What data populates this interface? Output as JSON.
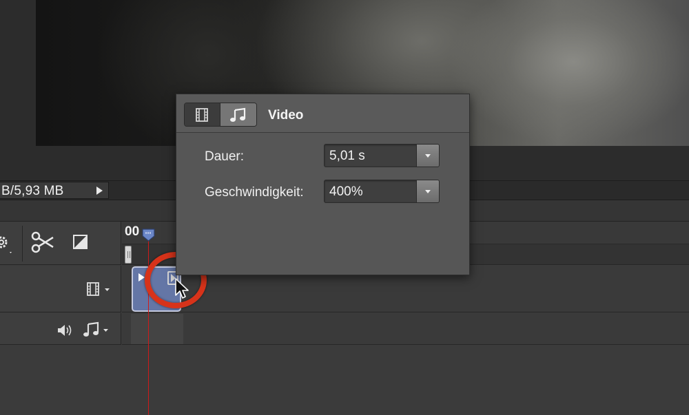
{
  "status": {
    "file_size": "B/5,93 MB"
  },
  "timeline": {
    "time_label": "00"
  },
  "inspector": {
    "title": "Video",
    "tabs": [
      {
        "icon": "film-icon",
        "selected": true
      },
      {
        "icon": "music-note-icon",
        "selected": false
      }
    ],
    "fields": {
      "duration": {
        "label": "Dauer:",
        "value": "5,01 s"
      },
      "speed": {
        "label": "Geschwindigkeit:",
        "value": "400%"
      }
    }
  },
  "colors": {
    "clip": "#6476a6",
    "playhead": "#d01a1a",
    "highlight": "#d7331a"
  }
}
